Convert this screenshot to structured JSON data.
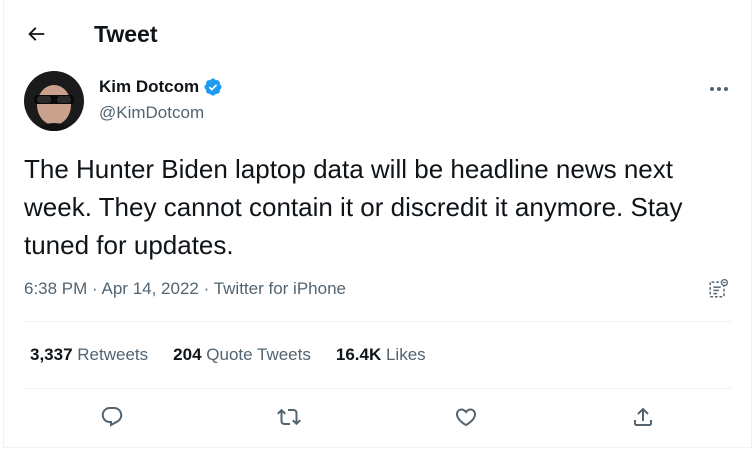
{
  "header": {
    "title": "Tweet",
    "back_icon": "arrow-left-icon"
  },
  "author": {
    "display_name": "Kim Dotcom",
    "handle": "@KimDotcom",
    "verified": true,
    "verified_color": "#1d9bf0"
  },
  "tweet": {
    "text": "The Hunter Biden laptop data will be headline news next week. They cannot contain it or discredit it anymore. Stay tuned for updates.",
    "time": "6:38 PM",
    "separator": "·",
    "date": "Apr 14, 2022",
    "source": "Twitter for iPhone"
  },
  "stats": {
    "retweets_count": "3,337",
    "retweets_label": "Retweets",
    "quotes_count": "204",
    "quotes_label": "Quote Tweets",
    "likes_count": "16.4K",
    "likes_label": "Likes"
  },
  "icons": {
    "more": "more-horizontal-icon",
    "analytics": "analytics-icon",
    "reply": "reply-icon",
    "retweet": "retweet-icon",
    "like": "heart-icon",
    "share": "share-icon"
  },
  "colors": {
    "text": "#0f1419",
    "secondary": "#536471",
    "divider": "#eff3f4",
    "accent": "#1d9bf0"
  }
}
